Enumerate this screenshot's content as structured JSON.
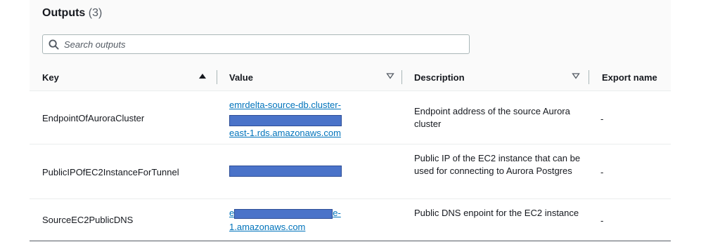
{
  "outputs": {
    "title": "Outputs",
    "count": "(3)",
    "search_placeholder": "Search outputs",
    "columns": {
      "key": "Key",
      "value": "Value",
      "description": "Description",
      "export_name": "Export name"
    },
    "rows": [
      {
        "key": "EndpointOfAuroraCluster",
        "value_line1": "emrdelta-source-db.cluster-",
        "value_line3": "east-1.rds.amazonaws.com",
        "description": "Endpoint address of the source Aurora cluster",
        "export_name": "-"
      },
      {
        "key": "PublicIPOfEC2InstanceForTunnel",
        "description": "Public IP of the EC2 instance that can be used for connecting to Aurora Postgres",
        "export_name": "-"
      },
      {
        "key": "SourceEC2PublicDNS",
        "value_line1_prefix": "e",
        "value_line1_suffix": "e-",
        "value_line2": "1.amazonaws.com",
        "description": "Public DNS enpoint for the EC2 instance",
        "export_name": "-"
      }
    ]
  },
  "colors": {
    "link": "#0073bb",
    "redaction": "#4a73c9"
  }
}
